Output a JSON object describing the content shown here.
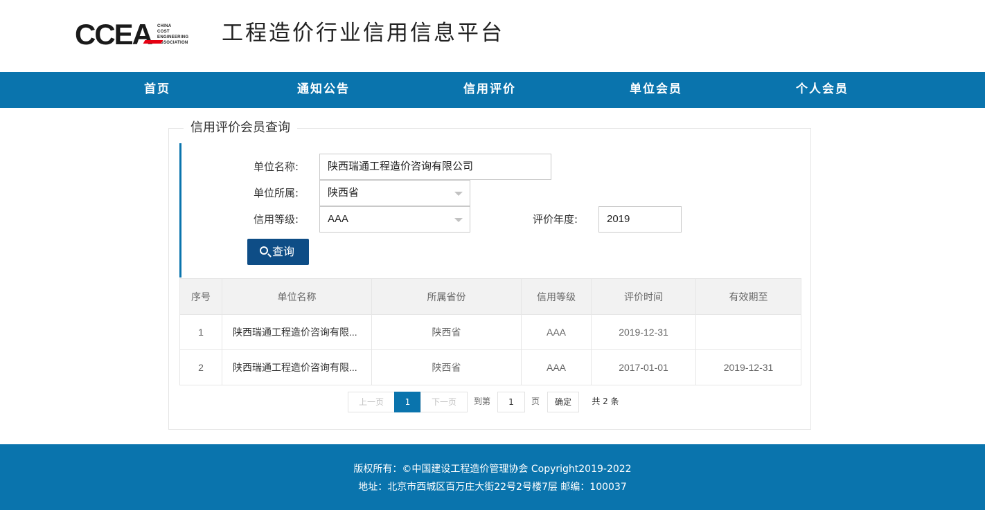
{
  "header": {
    "logo_text": "CCEA",
    "logo_sub": [
      "CHINA",
      "COST",
      "ENGINEERING",
      "ASSOCIATION"
    ],
    "site_title": "工程造价行业信用信息平台"
  },
  "nav": {
    "items": [
      "首页",
      "通知公告",
      "信用评价",
      "单位会员",
      "个人会员"
    ]
  },
  "search": {
    "legend": "信用评价会员查询",
    "unit_name_label": "单位名称:",
    "unit_name_value": "陕西瑞通工程造价咨询有限公司",
    "province_label": "单位所属:",
    "province_value": "陕西省",
    "grade_label": "信用等级:",
    "grade_value": "AAA",
    "year_label": "评价年度:",
    "year_value": "2019",
    "search_button": "查询"
  },
  "table": {
    "headers": [
      "序号",
      "单位名称",
      "所属省份",
      "信用等级",
      "评价时间",
      "有效期至"
    ],
    "rows": [
      [
        "1",
        "陕西瑞通工程造价咨询有限...",
        "陕西省",
        "AAA",
        "2019-12-31",
        ""
      ],
      [
        "2",
        "陕西瑞通工程造价咨询有限...",
        "陕西省",
        "AAA",
        "2017-01-01",
        "2019-12-31"
      ]
    ]
  },
  "pagination": {
    "prev": "上一页",
    "current": "1",
    "next": "下一页",
    "goto_label": "到第",
    "goto_value": "1",
    "page_unit": "页",
    "confirm": "确定",
    "total": "共 2 条"
  },
  "footer": {
    "copyright": "版权所有：©中国建设工程造价管理协会 Copyright2019-2022",
    "address": "地址：北京市西城区百万庄大街22号2号楼7层  邮编：100037"
  },
  "colors": {
    "primary": "#0a74ad",
    "button": "#0e4d86",
    "logo_red": "#e60012"
  }
}
